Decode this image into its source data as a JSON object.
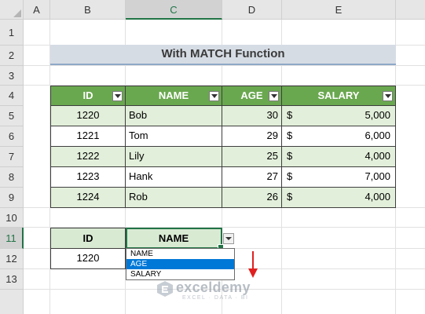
{
  "sheet": {
    "columns": [
      "A",
      "B",
      "C",
      "D",
      "E"
    ],
    "rows": [
      "1",
      "2",
      "3",
      "4",
      "5",
      "6",
      "7",
      "8",
      "9",
      "10",
      "11",
      "12",
      "13"
    ]
  },
  "title": "With MATCH Function",
  "table": {
    "headers": [
      "ID",
      "NAME",
      "AGE",
      "SALARY"
    ],
    "rows": [
      {
        "id": "1220",
        "name": "Bob",
        "age": "30",
        "currency": "$",
        "salary": "5,000"
      },
      {
        "id": "1221",
        "name": "Tom",
        "age": "29",
        "currency": "$",
        "salary": "6,000"
      },
      {
        "id": "1222",
        "name": "Lily",
        "age": "25",
        "currency": "$",
        "salary": "4,000"
      },
      {
        "id": "1223",
        "name": "Hank",
        "age": "27",
        "currency": "$",
        "salary": "7,000"
      },
      {
        "id": "1224",
        "name": "Rob",
        "age": "26",
        "currency": "$",
        "salary": "4,000"
      }
    ]
  },
  "lookup": {
    "header_id": "ID",
    "header_name": "NAME",
    "value_id": "1220"
  },
  "dropdown": {
    "options": [
      "NAME",
      "AGE",
      "SALARY"
    ],
    "selected_index": 1
  },
  "watermark": {
    "text": "exceldemy",
    "sub": "EXCEL · DATA · BI"
  },
  "colors": {
    "header_green": "#6aa84f",
    "band_green": "#e2efda",
    "selection_green": "#217346",
    "arrow_red": "#e02020"
  }
}
